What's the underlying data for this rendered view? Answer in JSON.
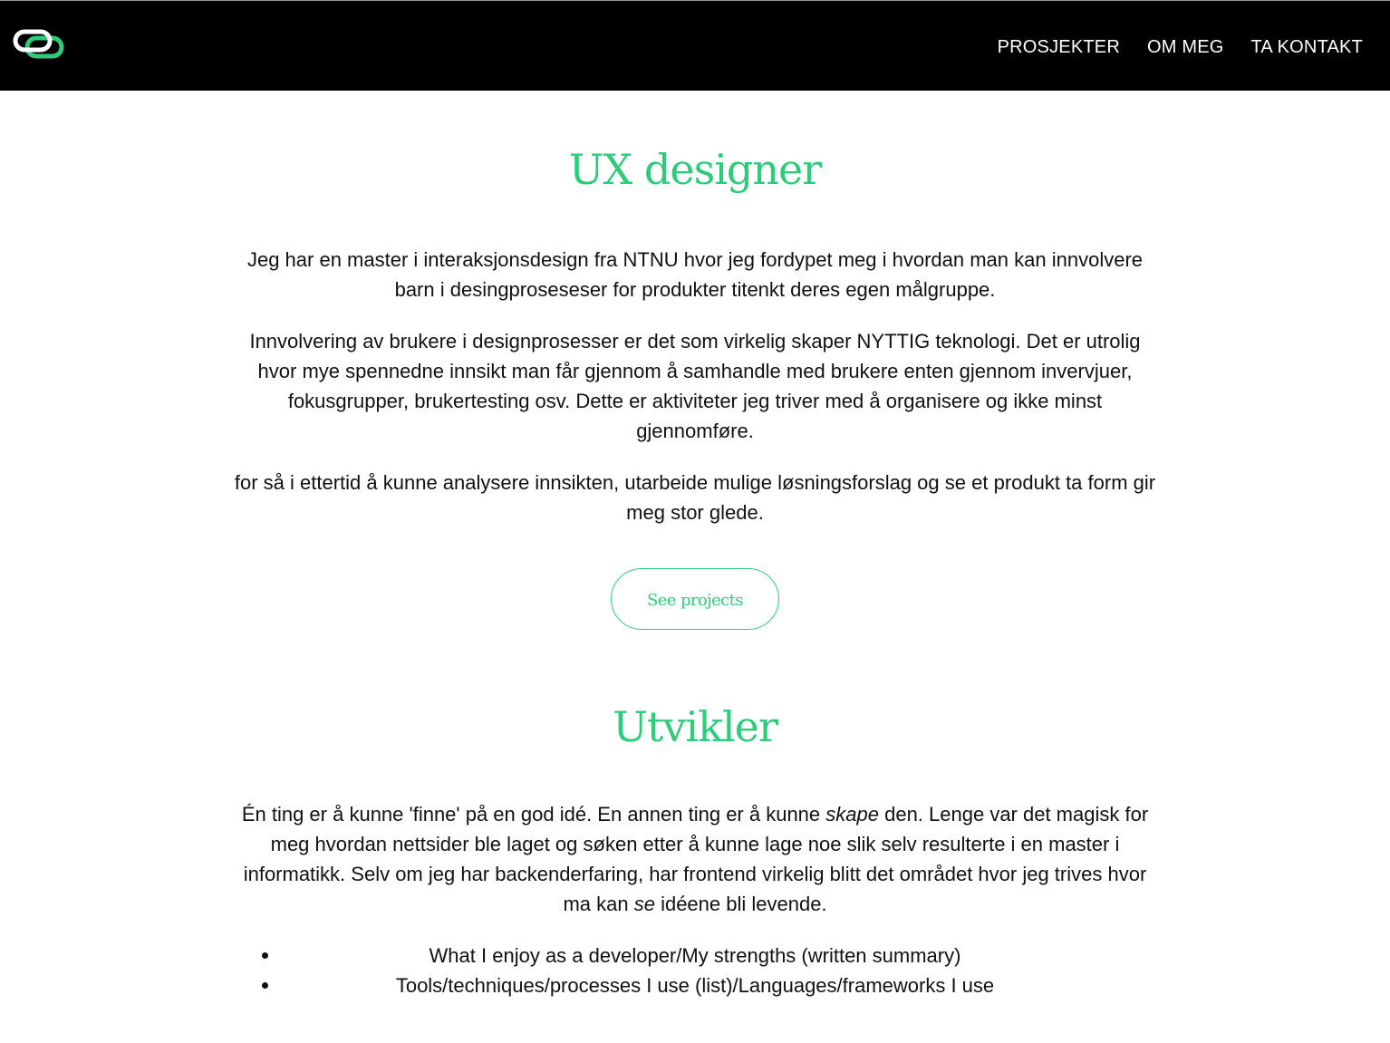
{
  "header": {
    "logo_icon": "linked-rings-logo-icon",
    "nav": [
      {
        "label": "PROSJEKTER"
      },
      {
        "label": "OM MEG"
      },
      {
        "label": "TA KONTAKT"
      }
    ]
  },
  "ux_section": {
    "title": "UX designer",
    "paragraphs": [
      "Jeg har en master i interaksjonsdesign fra NTNU hvor jeg fordypet meg i hvordan man kan innvolvere barn i desingproseseser for produkter titenkt deres egen målgruppe.",
      "Innvolvering av brukere i designprosesser er det som virkelig skaper NYTTIG teknologi. Det er utrolig hvor mye spennedne innsikt man får gjennom å samhandle med brukere enten gjennom invervjuer, fokusgrupper, brukertesting osv. Dette er aktiviteter jeg triver med å organisere og ikke minst gjennomføre.",
      "for så i ettertid å kunne analysere innsikten, utarbeide mulige løsningsforslag og se et produkt ta form gir meg stor glede."
    ],
    "button_label": "See projects"
  },
  "dev_section": {
    "title": "Utvikler",
    "paragraph_parts": {
      "p1": "Én ting er å kunne 'finne' på en god idé. En annen ting er å kunne ",
      "em1": "skape",
      "p2": " den. Lenge var det magisk for meg hvordan nettsider ble laget og søken etter å kunne lage noe slik selv resulterte i en master i informatikk. Selv om jeg har backenderfaring, har frontend virkelig blitt det området hvor jeg trives hvor ma kan ",
      "em2": "se",
      "p3": " idéene bli levende."
    },
    "list_items": [
      "What I enjoy as a developer/My strengths (written summary)",
      "Tools/techniques/processes I use (list)/Languages/frameworks I use"
    ]
  },
  "colors": {
    "accent": "#2ecc7a",
    "header_bg": "#000000",
    "text": "#111111"
  }
}
